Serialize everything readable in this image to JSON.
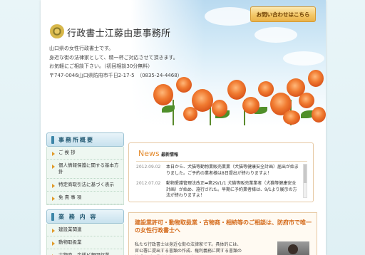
{
  "header": {
    "site_title": "行政書士江藤由恵事務所",
    "contact_button": "お問い合わせはこちら",
    "intro_lines": [
      "山口県の女性行政書士です。",
      "身近な街の法律家として、精一杯ご対応させて頂きます。",
      "お気軽にご相談下さい。（初回相談30分無料）",
      "〒747-0046山口県防府市千日2-17-5　（0835-24-4468）"
    ]
  },
  "sidebar": {
    "sections": [
      {
        "title": "事務所概要",
        "items": [
          "ご 挨 拶",
          "個人情報保護に関する基本方針",
          "特定商取引法に基づく表示",
          "免 責 事 項"
        ]
      },
      {
        "title": "業 務 内 容",
        "items": [
          "建設業関連",
          "動物取扱業",
          "古物商、金銭ビ類回収業"
        ]
      }
    ]
  },
  "news": {
    "title": "News",
    "subtitle": "最新情報",
    "items": [
      {
        "date": "2012.09.02",
        "text": "本日から、犬猫等動物業販売業業（犬猫等健康安全計画）届出が始まりました。ご予約の業者様は8日提出が終わりますよ！"
      },
      {
        "date": "2012.07.02",
        "text": "動物愛護管理法改正➡第29/1/1 犬猫等販売業業者（犬猫等健康安全計画）が始め、施行された。早期に予約業者様は、9/1より展示の方法が終わりますよ！"
      }
    ]
  },
  "feature": {
    "title": "建設業許可・動物取扱業・古物商・相続等のご相談は、防府市で唯一の女性行政書士へ",
    "text": "私たち行政書士は身近な街の法律家です。具体的には、官公署に提出する書類の作成、権利義務に関する書類の作成などの業務を行っています。"
  }
}
